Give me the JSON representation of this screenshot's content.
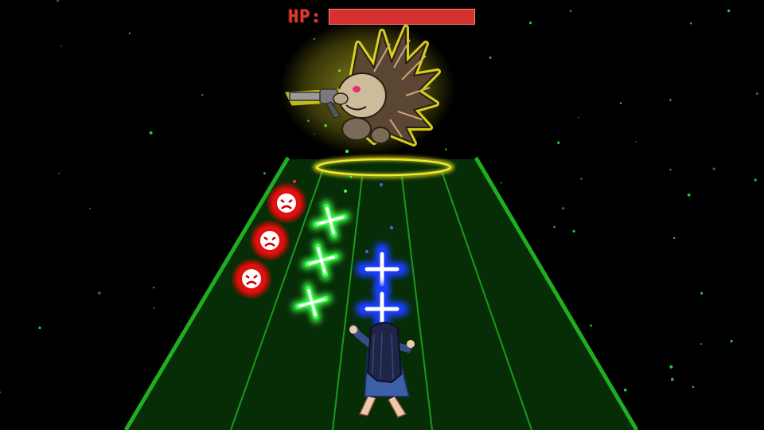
{
  "hud": {
    "hp_label": "HP:",
    "boss_hp_fraction": 1.0,
    "hp_fill_color": "#d43131"
  },
  "colors": {
    "background": "#000000",
    "track": "#0a3a0a",
    "track_edge": "#1fae1f",
    "lane_line": "#1a9a1a",
    "boss_aura": "#e8e020",
    "green_note": "#3cff4a",
    "blue_note": "#1a3cff",
    "red_note": "#e01010"
  },
  "entities": {
    "boss": "hedgehog-boss-with-revolver",
    "player": "girl-in-blue-dress-kneeling"
  },
  "notes": {
    "red_angry_faces": 3,
    "green_crosses": 3,
    "blue_crosses": 2
  }
}
